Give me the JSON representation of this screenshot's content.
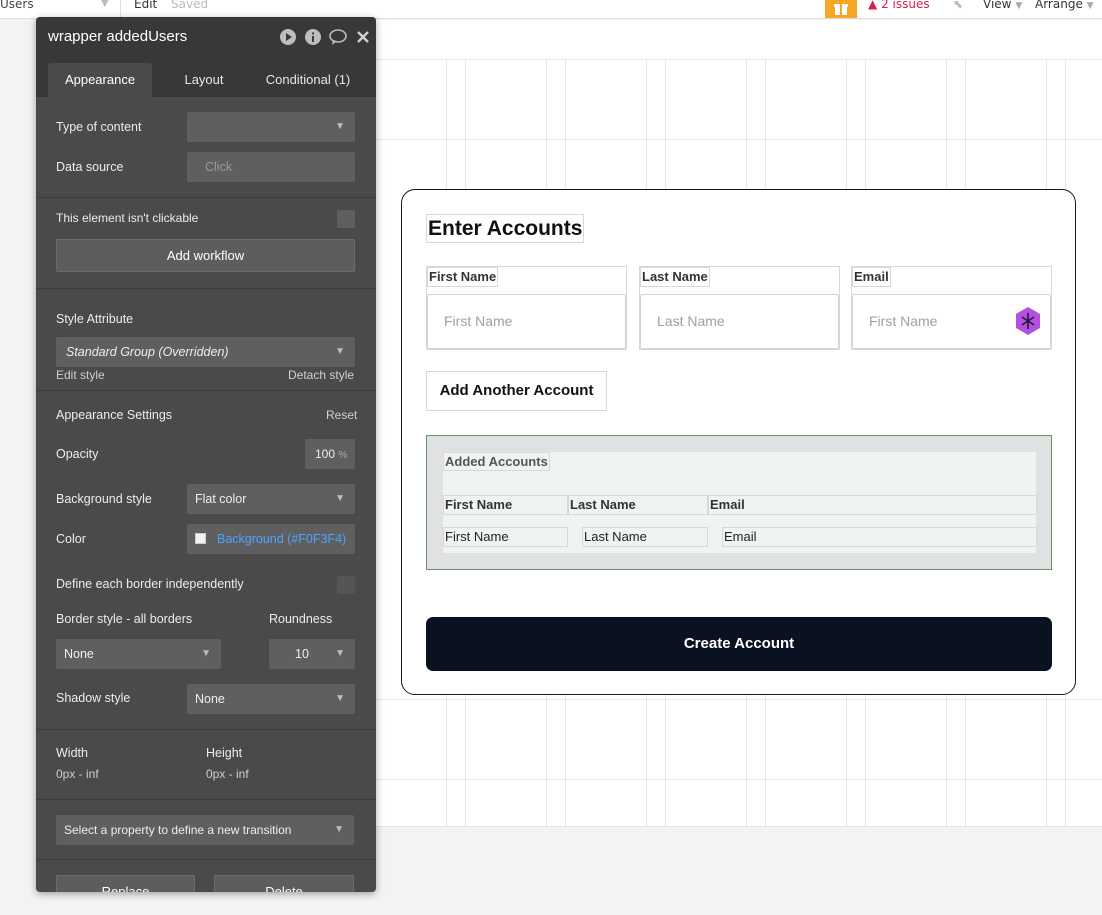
{
  "topbar": {
    "page_name": "Users",
    "edit": "Edit",
    "saved": "Saved",
    "issues": "2 issues",
    "view": "View",
    "arrange": "Arrange"
  },
  "popup": {
    "title": "Enter Accounts",
    "fields": [
      {
        "label": "First Name",
        "placeholder": "First Name"
      },
      {
        "label": "Last Name",
        "placeholder": "Last Name"
      },
      {
        "label": "Email",
        "placeholder": "First Name"
      }
    ],
    "add_button": "Add Another Account",
    "added": {
      "title": "Added Accounts",
      "headers": [
        "First Name",
        "Last Name",
        "Email"
      ],
      "row": [
        "First Name",
        "Last Name",
        "Email"
      ]
    },
    "create_button": "Create Account"
  },
  "panel": {
    "title": "wrapper addedUsers",
    "tabs": [
      "Appearance",
      "Layout",
      "Conditional (1)"
    ],
    "type_of_content_label": "Type of content",
    "type_of_content_value": "",
    "data_source_label": "Data source",
    "data_source_placeholder": "Click",
    "not_clickable_label": "This element isn't clickable",
    "add_workflow": "Add workflow",
    "style_attribute_label": "Style Attribute",
    "style_value": "Standard Group (Overridden)",
    "edit_style": "Edit style",
    "detach_style": "Detach style",
    "appearance_settings": "Appearance Settings",
    "reset": "Reset",
    "opacity_label": "Opacity",
    "opacity_value": "100",
    "opacity_unit": "%",
    "background_style_label": "Background style",
    "background_style_value": "Flat color",
    "color_label": "Color",
    "color_value": "Background (#F0F3F4)",
    "border_independent_label": "Define each border independently",
    "border_style_label": "Border style - all borders",
    "border_style_value": "None",
    "roundness_label": "Roundness",
    "roundness_value": "10",
    "shadow_style_label": "Shadow style",
    "shadow_style_value": "None",
    "width_label": "Width",
    "width_value": "0px - inf",
    "height_label": "Height",
    "height_value": "0px - inf",
    "transition_placeholder": "Select a property to define a new transition",
    "replace": "Replace",
    "delete": "Delete"
  },
  "colors": {
    "panel_bg": "#4a4a4a",
    "panel_header": "#383838",
    "accent_link": "#4da3ff",
    "issues_red": "#d6204e",
    "gift_orange": "#f5a623",
    "create_button_bg": "#0a1221",
    "group_bg": "#F0F3F4"
  }
}
